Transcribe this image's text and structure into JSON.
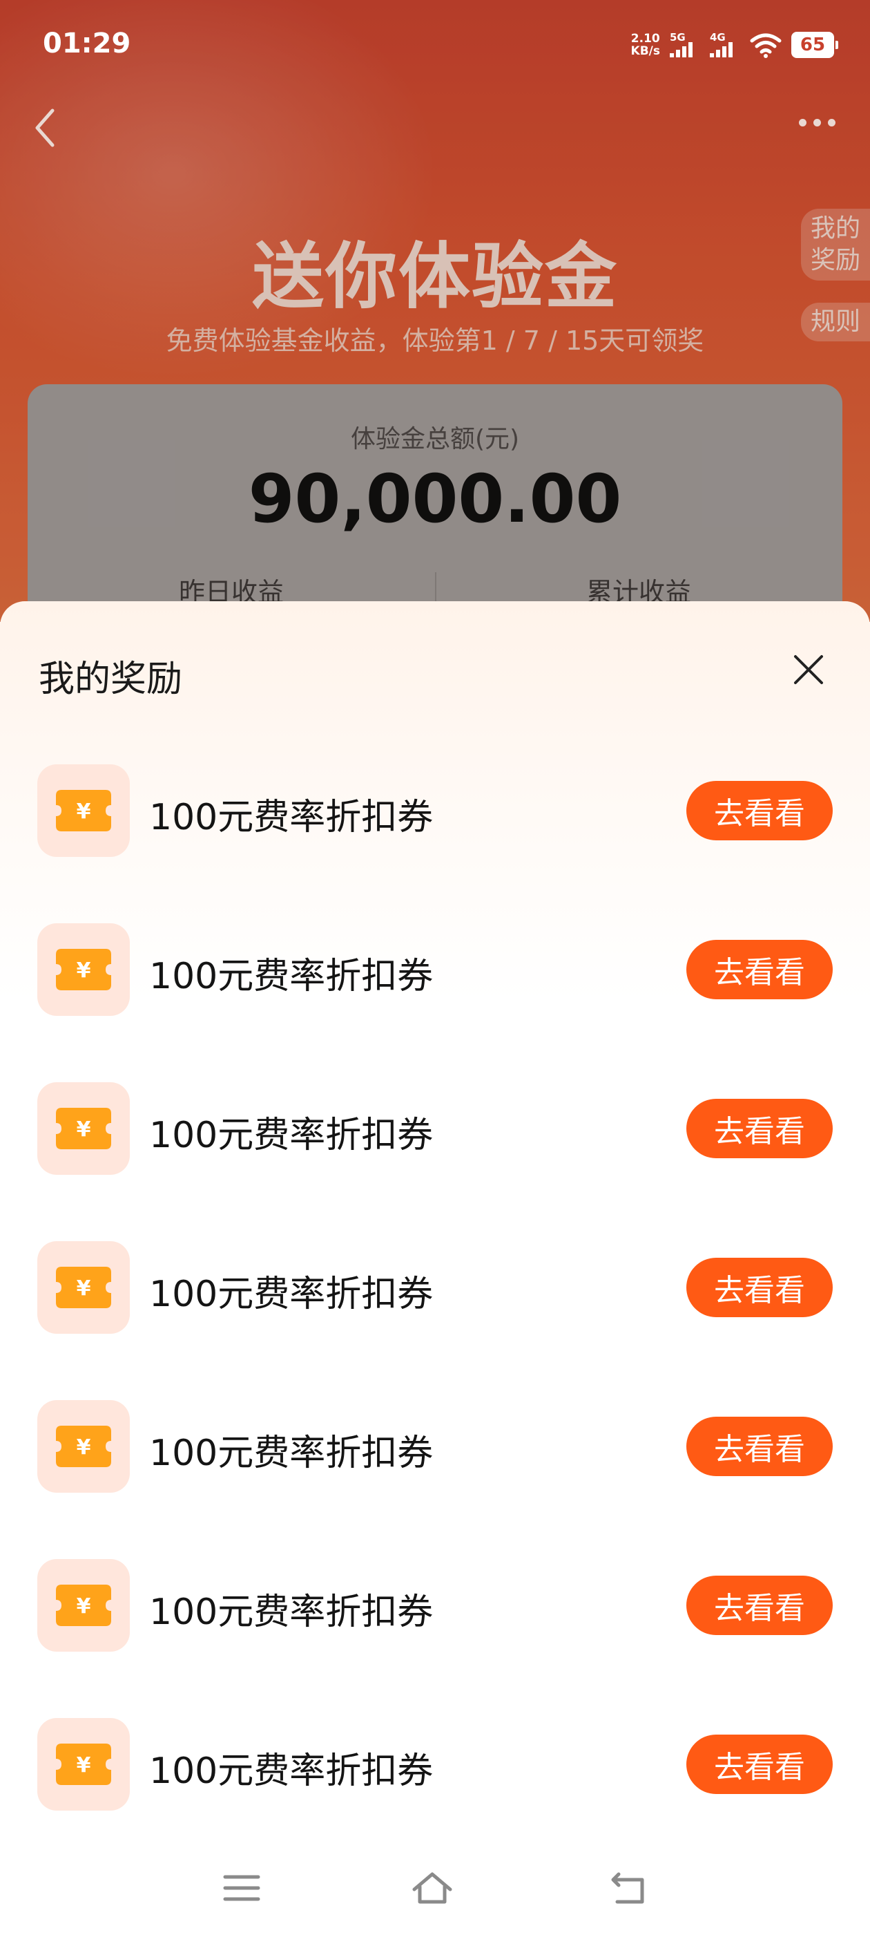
{
  "status_bar": {
    "time": "01:29",
    "speed_value": "2.10",
    "speed_unit": "KB/s",
    "net1": "5G",
    "net2": "4G",
    "battery": "65"
  },
  "header": {
    "back_icon": "chevron-left-icon",
    "more_icon": "more-dots-icon"
  },
  "hero": {
    "title": "送你体验金",
    "subtitle": "免费体验基金收益，体验第1 / 7 / 15天可领奖"
  },
  "side_tabs": {
    "my_rewards_line1": "我的",
    "my_rewards_line2": "奖励",
    "rules": "规则"
  },
  "summary": {
    "label": "体验金总额(元)",
    "amount": "90,000.00",
    "yesterday_label": "昨日收益",
    "total_label": "累计收益"
  },
  "sheet": {
    "title": "我的奖励",
    "close_icon": "close-icon",
    "items": [
      {
        "name": "100元费率折扣券",
        "button": "去看看",
        "icon": "coupon-yuan-icon"
      },
      {
        "name": "100元费率折扣券",
        "button": "去看看",
        "icon": "coupon-yuan-icon"
      },
      {
        "name": "100元费率折扣券",
        "button": "去看看",
        "icon": "coupon-yuan-icon"
      },
      {
        "name": "100元费率折扣券",
        "button": "去看看",
        "icon": "coupon-yuan-icon"
      },
      {
        "name": "100元费率折扣券",
        "button": "去看看",
        "icon": "coupon-yuan-icon"
      },
      {
        "name": "100元费率折扣券",
        "button": "去看看",
        "icon": "coupon-yuan-icon"
      },
      {
        "name": "100元费率折扣券",
        "button": "去看看",
        "icon": "coupon-yuan-icon"
      }
    ]
  },
  "colors": {
    "accent": "#ff5a14",
    "coupon": "#ffa31a",
    "hero_bg": "#d8532f"
  }
}
